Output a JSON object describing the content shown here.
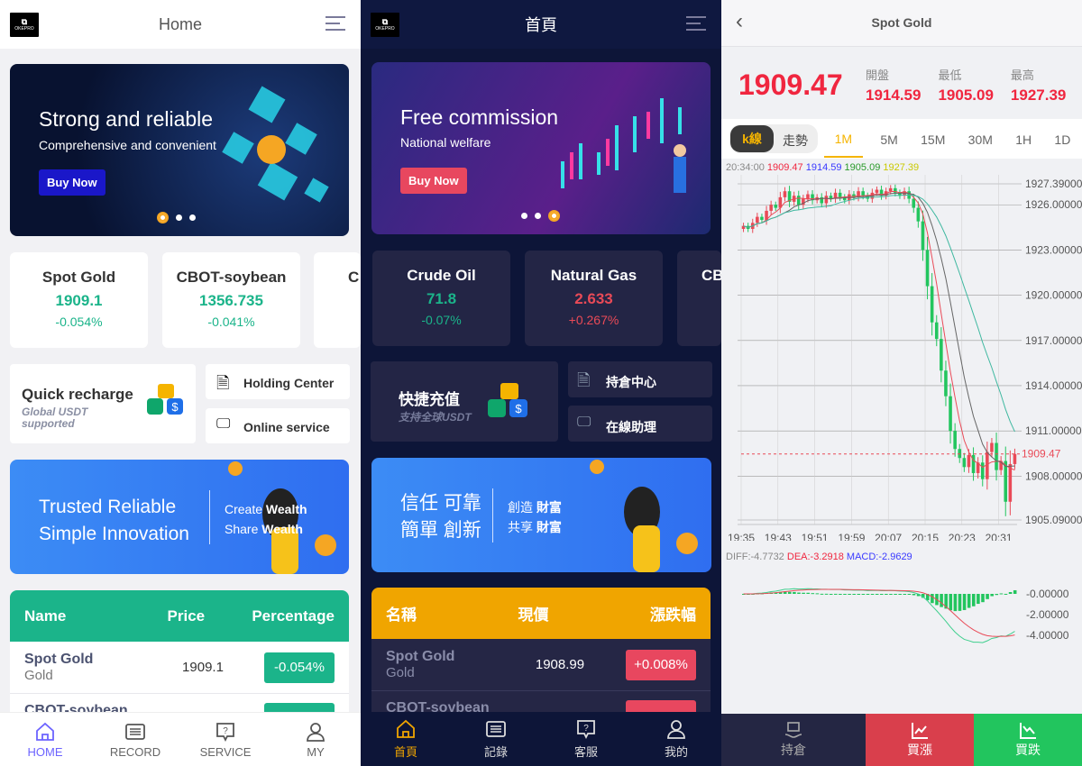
{
  "light": {
    "header": {
      "title": "Home",
      "logo_text": "OKEPRO"
    },
    "banner": {
      "title": "Strong and reliable",
      "subtitle": "Comprehensive and convenient",
      "button": "Buy Now"
    },
    "quotes": [
      {
        "name": "Spot Gold",
        "price": "1909.1",
        "change": "-0.054%"
      },
      {
        "name": "CBOT-soybean",
        "price": "1356.735",
        "change": "-0.041%"
      },
      {
        "name": "C",
        "price": "",
        "change": ""
      }
    ],
    "recharge": {
      "title": "Quick recharge",
      "subtitle": "Global USDT supported"
    },
    "holding": "Holding Center",
    "service": "Online service",
    "promo": {
      "line1": "Trusted Reliable",
      "line2": "Simple Innovation",
      "r1a": "Create",
      "r1b": "Wealth",
      "r2a": "Share",
      "r2b": "Wealth"
    },
    "table": {
      "headers": [
        "Name",
        "Price",
        "Percentage"
      ],
      "rows": [
        {
          "name": "Spot Gold",
          "sub": "Gold",
          "price": "1909.1",
          "change": "-0.054%"
        },
        {
          "name": "CBOT-soybean",
          "sub": "",
          "price": "",
          "change": ""
        }
      ]
    },
    "nav": [
      {
        "label": "HOME",
        "icon": "home-icon"
      },
      {
        "label": "RECORD",
        "icon": "list-icon"
      },
      {
        "label": "SERVICE",
        "icon": "help-chat-icon"
      },
      {
        "label": "MY",
        "icon": "user-icon"
      }
    ],
    "colors": {
      "accent": "#1bb48a",
      "nav_active": "#6c63ff"
    }
  },
  "dark": {
    "header": {
      "title": "首頁",
      "logo_text": "OKEPRO"
    },
    "banner": {
      "title": "Free commission",
      "subtitle": "National welfare",
      "button": "Buy Now"
    },
    "quotes": [
      {
        "name": "Crude Oil",
        "price": "71.8",
        "change": "-0.07%",
        "dir": "down"
      },
      {
        "name": "Natural Gas",
        "price": "2.633",
        "change": "+0.267%",
        "dir": "up"
      },
      {
        "name": "CB",
        "price": "",
        "change": ""
      }
    ],
    "recharge": {
      "title": "快捷充值",
      "subtitle": "支持全球USDT"
    },
    "holding": "持倉中心",
    "service": "在線助理",
    "promo": {
      "line1": "信任 可靠",
      "line2": "簡單 創新",
      "r1a": "創造",
      "r1b": "財富",
      "r2a": "共享",
      "r2b": "財富"
    },
    "table": {
      "headers": [
        "名稱",
        "現價",
        "漲跌幅"
      ],
      "rows": [
        {
          "name": "Spot Gold",
          "sub": "Gold",
          "price": "1908.99",
          "change": "+0.008%"
        },
        {
          "name": "CBOT-soybean",
          "sub": "",
          "price": "",
          "change": ""
        }
      ]
    },
    "nav": [
      {
        "label": "首頁",
        "icon": "home-icon"
      },
      {
        "label": "記錄",
        "icon": "list-icon"
      },
      {
        "label": "客服",
        "icon": "help-chat-icon"
      },
      {
        "label": "我的",
        "icon": "user-icon"
      }
    ],
    "colors": {
      "accent": "#f0a500",
      "bg": "#0d1538"
    }
  },
  "detail": {
    "title": "Spot Gold",
    "price": "1909.47",
    "stats": [
      {
        "label": "開盤",
        "value": "1914.59"
      },
      {
        "label": "最低",
        "value": "1905.09"
      },
      {
        "label": "最高",
        "value": "1927.39"
      }
    ],
    "mode_tabs": [
      "k線",
      "走勢"
    ],
    "intervals": [
      "1M",
      "5M",
      "15M",
      "30M",
      "1H",
      "1D"
    ],
    "active_interval": "1M",
    "ohlc_line": {
      "time": "20:34:00",
      "close": "1909.47",
      "open": "1914.59",
      "low": "1905.09",
      "high": "1927.39"
    },
    "macd_line": {
      "diff": "DIFF:-4.7732",
      "dea": "DEA:-3.2918",
      "macd": "MACD:-2.9629"
    },
    "buttons": [
      {
        "label": "持倉",
        "icon": "holding-icon"
      },
      {
        "label": "買漲",
        "icon": "chart-up-icon"
      },
      {
        "label": "買跌",
        "icon": "chart-down-icon"
      }
    ],
    "colors": {
      "up": "#e94a57",
      "down": "#22c55e",
      "price": "#f0263f"
    }
  },
  "chart_data": {
    "type": "candlestick",
    "price_ticks": [
      "1927.39000",
      "1926.00000",
      "1923.00000",
      "1920.00000",
      "1917.00000",
      "1914.00000",
      "1911.00000",
      "1908.00000",
      "1905.09000"
    ],
    "last_price_label": "1909.47",
    "time_ticks": [
      "19:35",
      "19:43",
      "19:51",
      "19:59",
      "20:07",
      "20:15",
      "20:23",
      "20:31"
    ],
    "ylim": [
      1905.09,
      1927.39
    ],
    "closes": [
      1924.6,
      1924.4,
      1924.8,
      1925.2,
      1925.0,
      1925.6,
      1926.0,
      1925.8,
      1926.5,
      1926.9,
      1926.2,
      1926.6,
      1926.0,
      1926.4,
      1926.7,
      1926.3,
      1926.5,
      1926.1,
      1926.6,
      1926.4,
      1926.8,
      1926.5,
      1926.3,
      1926.7,
      1926.5,
      1926.9,
      1926.6,
      1926.4,
      1926.8,
      1927.0,
      1926.6,
      1926.9,
      1927.1,
      1926.8,
      1926.6,
      1926.9,
      1926.4,
      1925.8,
      1924.9,
      1923.0,
      1920.6,
      1918.2,
      1917.1,
      1915.0,
      1913.3,
      1911.0,
      1909.8,
      1909.2,
      1908.6,
      1909.4,
      1908.2,
      1908.9,
      1907.8,
      1909.6,
      1910.2,
      1908.4,
      1909.0,
      1906.3,
      1908.8,
      1909.47
    ],
    "macd_ticks": [
      "-0.00000",
      "-2.00000",
      "-4.00000"
    ]
  }
}
